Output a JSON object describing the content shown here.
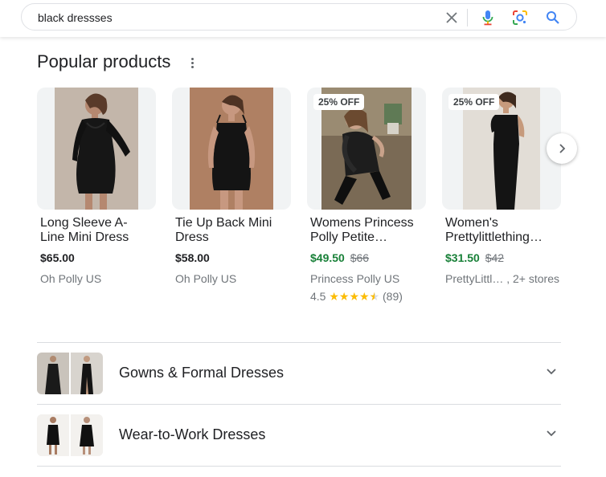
{
  "search": {
    "query": "black dressses",
    "icons": [
      "close-icon",
      "microphone-icon",
      "google-lens-icon",
      "search-icon"
    ]
  },
  "popular": {
    "title": "Popular products",
    "products": [
      {
        "title_line1": "Long Sleeve A-",
        "title_line2": "Line Mini Dress",
        "price": "$65.00",
        "old_price": "",
        "store": "Oh Polly US",
        "badge": "",
        "rating": "",
        "reviews": ""
      },
      {
        "title_line1": "Tie Up Back Mini",
        "title_line2": "Dress",
        "price": "$58.00",
        "old_price": "",
        "store": "Oh Polly US",
        "badge": "",
        "rating": "",
        "reviews": ""
      },
      {
        "title_line1": "Womens Princess",
        "title_line2": "Polly Petite…",
        "price": "$49.50",
        "old_price": "$66",
        "store": "Princess Polly US",
        "badge": "25% OFF",
        "rating": "4.5",
        "stars_value": 4.5,
        "reviews": "(89)"
      },
      {
        "title_line1": "Women's",
        "title_line2": "Prettylittlething…",
        "price": "$31.50",
        "old_price": "$42",
        "store": "PrettyLittl… , 2+ stores",
        "badge": "25% OFF",
        "rating": "",
        "reviews": ""
      }
    ]
  },
  "categories": [
    {
      "label": "Gowns & Formal Dresses"
    },
    {
      "label": "Wear-to-Work Dresses"
    }
  ],
  "colors": {
    "sale_price": "#188038",
    "star": "#fbbc04",
    "muted_text": "#70757a",
    "divider": "#dadce0"
  }
}
